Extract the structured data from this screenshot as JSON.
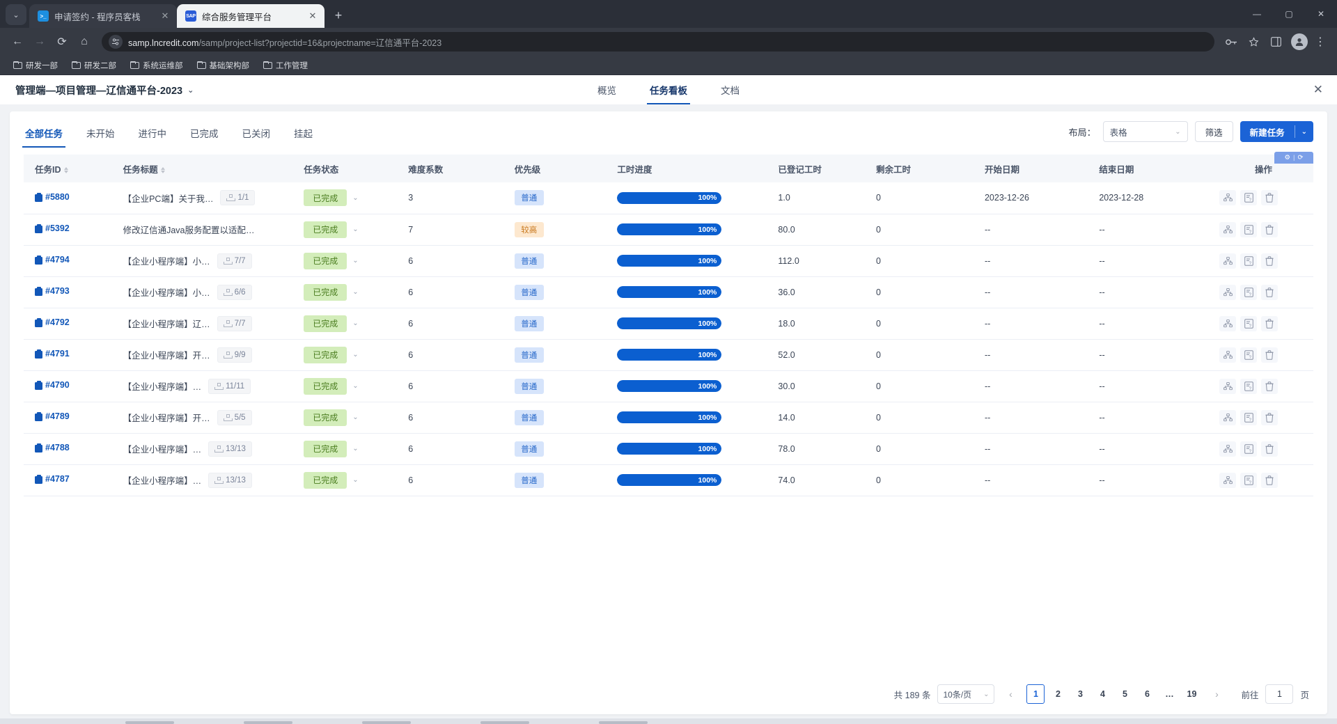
{
  "browser": {
    "tabs": [
      {
        "title": "申请签约 - 程序员客栈",
        "favicon": "terminal-icon",
        "active": false
      },
      {
        "title": "综合服务管理平台",
        "favicon": "sap-icon",
        "active": true
      }
    ],
    "new_tab_label": "+",
    "window_controls": {
      "minimize": "—",
      "maximize": "▢",
      "close": "✕"
    },
    "nav": {
      "back": "←",
      "forward": "→",
      "reload": "⟳",
      "home": "⌂"
    },
    "omnibox": {
      "url_main": "samp.lncredit.com",
      "url_path": "/samp/project-list?projectid=16&projectname=辽信通平台-2023"
    },
    "toolbar_icons": {
      "password": "key-icon",
      "bookmark": "star-icon",
      "panel": "side-panel-icon",
      "profile": "avatar-icon"
    },
    "bookmarks": [
      "研发一部",
      "研发二部",
      "系统运维部",
      "基础架构部",
      "工作管理"
    ]
  },
  "header": {
    "project_title": "管理端—项目管理—辽信通平台-2023",
    "title_caret": "⌄",
    "tabs": [
      {
        "label": "概览",
        "active": false
      },
      {
        "label": "任务看板",
        "active": true
      },
      {
        "label": "文档",
        "active": false
      }
    ],
    "close": "✕"
  },
  "filters": {
    "tabs": [
      {
        "label": "全部任务",
        "active": true
      },
      {
        "label": "未开始",
        "active": false
      },
      {
        "label": "进行中",
        "active": false
      },
      {
        "label": "已完成",
        "active": false
      },
      {
        "label": "已关闭",
        "active": false
      },
      {
        "label": "挂起",
        "active": false
      }
    ]
  },
  "toolbar": {
    "layout_label": "布局：",
    "layout_value": "表格",
    "filter_button": "筛选",
    "new_task_button": "新建任务",
    "new_task_caret": "⌄",
    "grid_widget": {
      "gear": "⚙",
      "separator": "|",
      "refresh": "⟳"
    }
  },
  "table": {
    "columns": [
      {
        "key": "id",
        "label": "任务ID",
        "sortable": true
      },
      {
        "key": "title",
        "label": "任务标题",
        "sortable": true
      },
      {
        "key": "status",
        "label": "任务状态",
        "sortable": false
      },
      {
        "key": "difficulty",
        "label": "难度系数",
        "sortable": false
      },
      {
        "key": "priority",
        "label": "优先级",
        "sortable": false
      },
      {
        "key": "progress",
        "label": "工时进度",
        "sortable": false
      },
      {
        "key": "logged",
        "label": "已登记工时",
        "sortable": false
      },
      {
        "key": "remaining",
        "label": "剩余工时",
        "sortable": false
      },
      {
        "key": "start",
        "label": "开始日期",
        "sortable": false
      },
      {
        "key": "end",
        "label": "结束日期",
        "sortable": false
      },
      {
        "key": "ops",
        "label": "操作",
        "sortable": false
      }
    ],
    "rows": [
      {
        "id": "#5880",
        "title": "【企业PC端】关于我…",
        "subtasks": "1/1",
        "status": "已完成",
        "difficulty": "3",
        "priority": "普通",
        "priority_type": "normal",
        "progress": "100%",
        "progress_value": 100,
        "logged": "1.0",
        "remaining": "0",
        "start": "2023-12-26",
        "end": "2023-12-28"
      },
      {
        "id": "#5392",
        "title": "修改辽信通Java服务配置以适配…",
        "subtasks": "",
        "status": "已完成",
        "difficulty": "7",
        "priority": "较高",
        "priority_type": "high",
        "progress": "100%",
        "progress_value": 100,
        "logged": "80.0",
        "remaining": "0",
        "start": "--",
        "end": "--"
      },
      {
        "id": "#4794",
        "title": "【企业小程序端】小…",
        "subtasks": "7/7",
        "status": "已完成",
        "difficulty": "6",
        "priority": "普通",
        "priority_type": "normal",
        "progress": "100%",
        "progress_value": 100,
        "logged": "112.0",
        "remaining": "0",
        "start": "--",
        "end": "--"
      },
      {
        "id": "#4793",
        "title": "【企业小程序端】小…",
        "subtasks": "6/6",
        "status": "已完成",
        "difficulty": "6",
        "priority": "普通",
        "priority_type": "normal",
        "progress": "100%",
        "progress_value": 100,
        "logged": "36.0",
        "remaining": "0",
        "start": "--",
        "end": "--"
      },
      {
        "id": "#4792",
        "title": "【企业小程序端】辽…",
        "subtasks": "7/7",
        "status": "已完成",
        "difficulty": "6",
        "priority": "普通",
        "priority_type": "normal",
        "progress": "100%",
        "progress_value": 100,
        "logged": "18.0",
        "remaining": "0",
        "start": "--",
        "end": "--"
      },
      {
        "id": "#4791",
        "title": "【企业小程序端】开…",
        "subtasks": "9/9",
        "status": "已完成",
        "difficulty": "6",
        "priority": "普通",
        "priority_type": "normal",
        "progress": "100%",
        "progress_value": 100,
        "logged": "52.0",
        "remaining": "0",
        "start": "--",
        "end": "--"
      },
      {
        "id": "#4790",
        "title": "【企业小程序端】…",
        "subtasks": "11/11",
        "status": "已完成",
        "difficulty": "6",
        "priority": "普通",
        "priority_type": "normal",
        "progress": "100%",
        "progress_value": 100,
        "logged": "30.0",
        "remaining": "0",
        "start": "--",
        "end": "--"
      },
      {
        "id": "#4789",
        "title": "【企业小程序端】开…",
        "subtasks": "5/5",
        "status": "已完成",
        "difficulty": "6",
        "priority": "普通",
        "priority_type": "normal",
        "progress": "100%",
        "progress_value": 100,
        "logged": "14.0",
        "remaining": "0",
        "start": "--",
        "end": "--"
      },
      {
        "id": "#4788",
        "title": "【企业小程序端】…",
        "subtasks": "13/13",
        "status": "已完成",
        "difficulty": "6",
        "priority": "普通",
        "priority_type": "normal",
        "progress": "100%",
        "progress_value": 100,
        "logged": "78.0",
        "remaining": "0",
        "start": "--",
        "end": "--"
      },
      {
        "id": "#4787",
        "title": "【企业小程序端】…",
        "subtasks": "13/13",
        "status": "已完成",
        "difficulty": "6",
        "priority": "普通",
        "priority_type": "normal",
        "progress": "100%",
        "progress_value": 100,
        "logged": "74.0",
        "remaining": "0",
        "start": "--",
        "end": "--"
      }
    ],
    "status_caret": "⌄",
    "op_icons": [
      "sitemap-icon",
      "doc-question-icon",
      "trash-icon"
    ]
  },
  "pagination": {
    "total_text": "共 189 条",
    "page_size": "10条/页",
    "page_size_caret": "⌄",
    "prev": "‹",
    "next": "›",
    "pages": [
      "1",
      "2",
      "3",
      "4",
      "5",
      "6",
      "…",
      "19"
    ],
    "current_page": "1",
    "goto_label": "前往",
    "goto_value": "1",
    "goto_unit": "页"
  },
  "colors": {
    "accent": "#1b63d6",
    "progress_fill": "#0b5fd0",
    "status_done_bg": "#d3edba",
    "status_done_fg": "#4b7e20",
    "priority_normal_bg": "#d6e4fb",
    "priority_high_bg": "#fde8cf"
  }
}
